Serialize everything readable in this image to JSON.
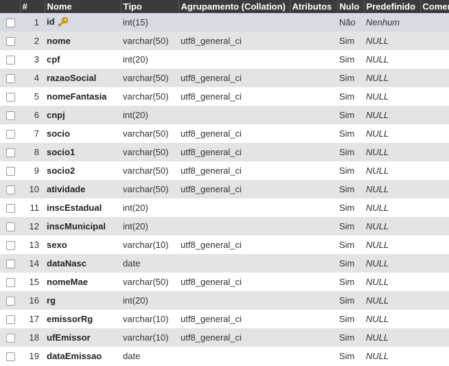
{
  "headers": {
    "num": "#",
    "name": "Nome",
    "type": "Tipo",
    "collation": "Agrupamento (Collation)",
    "attributes": "Atributos",
    "null": "Nulo",
    "default": "Predefinido",
    "comments": "Comer"
  },
  "rows": [
    {
      "num": "1",
      "name": "id",
      "type": "int(15)",
      "collation": "",
      "null": "Não",
      "default": "Nenhum",
      "icon": "key-icon"
    },
    {
      "num": "2",
      "name": "nome",
      "type": "varchar(50)",
      "collation": "utf8_general_ci",
      "null": "Sim",
      "default": "NULL"
    },
    {
      "num": "3",
      "name": "cpf",
      "type": "int(20)",
      "collation": "",
      "null": "Sim",
      "default": "NULL"
    },
    {
      "num": "4",
      "name": "razaoSocial",
      "type": "varchar(50)",
      "collation": "utf8_general_ci",
      "null": "Sim",
      "default": "NULL"
    },
    {
      "num": "5",
      "name": "nomeFantasia",
      "type": "varchar(50)",
      "collation": "utf8_general_ci",
      "null": "Sim",
      "default": "NULL"
    },
    {
      "num": "6",
      "name": "cnpj",
      "type": "int(20)",
      "collation": "",
      "null": "Sim",
      "default": "NULL"
    },
    {
      "num": "7",
      "name": "socio",
      "type": "varchar(50)",
      "collation": "utf8_general_ci",
      "null": "Sim",
      "default": "NULL"
    },
    {
      "num": "8",
      "name": "socio1",
      "type": "varchar(50)",
      "collation": "utf8_general_ci",
      "null": "Sim",
      "default": "NULL"
    },
    {
      "num": "9",
      "name": "socio2",
      "type": "varchar(50)",
      "collation": "utf8_general_ci",
      "null": "Sim",
      "default": "NULL"
    },
    {
      "num": "10",
      "name": "atividade",
      "type": "varchar(50)",
      "collation": "utf8_general_ci",
      "null": "Sim",
      "default": "NULL"
    },
    {
      "num": "11",
      "name": "inscEstadual",
      "type": "int(20)",
      "collation": "",
      "null": "Sim",
      "default": "NULL"
    },
    {
      "num": "12",
      "name": "inscMunicipal",
      "type": "int(20)",
      "collation": "",
      "null": "Sim",
      "default": "NULL"
    },
    {
      "num": "13",
      "name": "sexo",
      "type": "varchar(10)",
      "collation": "utf8_general_ci",
      "null": "Sim",
      "default": "NULL"
    },
    {
      "num": "14",
      "name": "dataNasc",
      "type": "date",
      "collation": "",
      "null": "Sim",
      "default": "NULL"
    },
    {
      "num": "15",
      "name": "nomeMae",
      "type": "varchar(50)",
      "collation": "utf8_general_ci",
      "null": "Sim",
      "default": "NULL"
    },
    {
      "num": "16",
      "name": "rg",
      "type": "int(20)",
      "collation": "",
      "null": "Sim",
      "default": "NULL"
    },
    {
      "num": "17",
      "name": "emissorRg",
      "type": "varchar(10)",
      "collation": "utf8_general_ci",
      "null": "Sim",
      "default": "NULL"
    },
    {
      "num": "18",
      "name": "ufEmissor",
      "type": "varchar(10)",
      "collation": "utf8_general_ci",
      "null": "Sim",
      "default": "NULL"
    },
    {
      "num": "19",
      "name": "dataEmissao",
      "type": "date",
      "collation": "",
      "null": "Sim",
      "default": "NULL"
    }
  ],
  "colors": {
    "header_bg": "#3b3b3b",
    "row_even": "#e4e4e4",
    "row_selected": "#d9dbe4",
    "key_icon": "#e0a800"
  }
}
